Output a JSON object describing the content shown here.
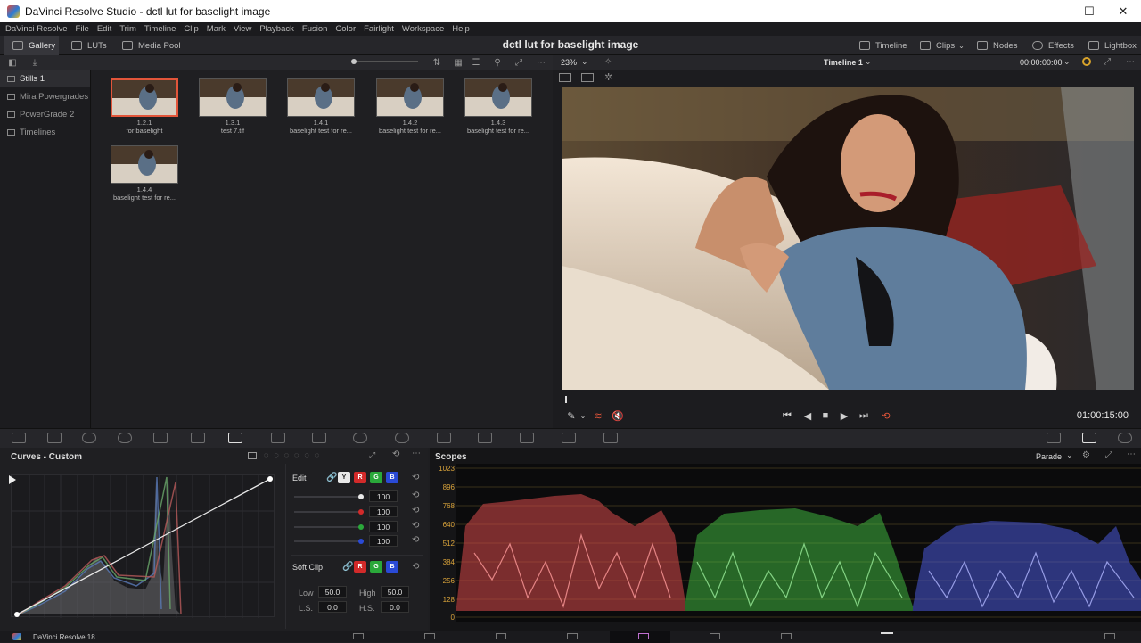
{
  "window": {
    "title": "DaVinci Resolve Studio - dctl lut for baselight image",
    "minimize": "—",
    "maximize": "☐",
    "close": "✕"
  },
  "menu": [
    "DaVinci Resolve",
    "File",
    "Edit",
    "Trim",
    "Timeline",
    "Clip",
    "Mark",
    "View",
    "Playback",
    "Fusion",
    "Color",
    "Fairlight",
    "Workspace",
    "Help"
  ],
  "toolbar": {
    "gallery": "Gallery",
    "luts": "LUTs",
    "media_pool": "Media Pool",
    "project_title": "dctl lut for baselight image",
    "timeline": "Timeline",
    "clips": "Clips",
    "nodes": "Nodes",
    "effects": "Effects",
    "lightbox": "Lightbox"
  },
  "sidebar": {
    "items": [
      {
        "label": "Stills 1",
        "active": true
      },
      {
        "label": "Mira Powergrades",
        "active": false
      },
      {
        "label": "PowerGrade 2",
        "active": false
      },
      {
        "label": "Timelines",
        "active": false
      }
    ]
  },
  "stills": [
    {
      "id": "1.2.1",
      "name": "for baselight"
    },
    {
      "id": "1.3.1",
      "name": "test 7.tif"
    },
    {
      "id": "1.4.1",
      "name": "baselight test for re..."
    },
    {
      "id": "1.4.2",
      "name": "baselight test for re..."
    },
    {
      "id": "1.4.3",
      "name": "baselight test for re..."
    },
    {
      "id": "1.4.4",
      "name": "baselight test for re..."
    }
  ],
  "viewer": {
    "zoom": "23%",
    "timeline_name": "Timeline 1",
    "timecode_top": "00:00:00:00",
    "timecode": "01:00:15:00"
  },
  "curves": {
    "title": "Curves - Custom",
    "edit_label": "Edit",
    "channel_buttons": [
      "Y",
      "R",
      "G",
      "B"
    ],
    "intensity_values": [
      "100",
      "100",
      "100",
      "100"
    ],
    "soft_clip_label": "Soft Clip",
    "soft_clip_buttons": [
      "R",
      "G",
      "B"
    ],
    "low_label": "Low",
    "low_value": "50.0",
    "high_label": "High",
    "high_value": "50.0",
    "ls_label": "L.S.",
    "ls_value": "0.0",
    "hs_label": "H.S.",
    "hs_value": "0.0"
  },
  "scopes": {
    "title": "Scopes",
    "mode": "Parade",
    "ticks": [
      "1023",
      "896",
      "768",
      "640",
      "512",
      "384",
      "256",
      "128",
      "0"
    ]
  },
  "bottom": {
    "app_label": "DaVinci Resolve 18"
  },
  "colors": {
    "accent_red": "#e2553a",
    "scope_tick": "#d9a33a"
  }
}
